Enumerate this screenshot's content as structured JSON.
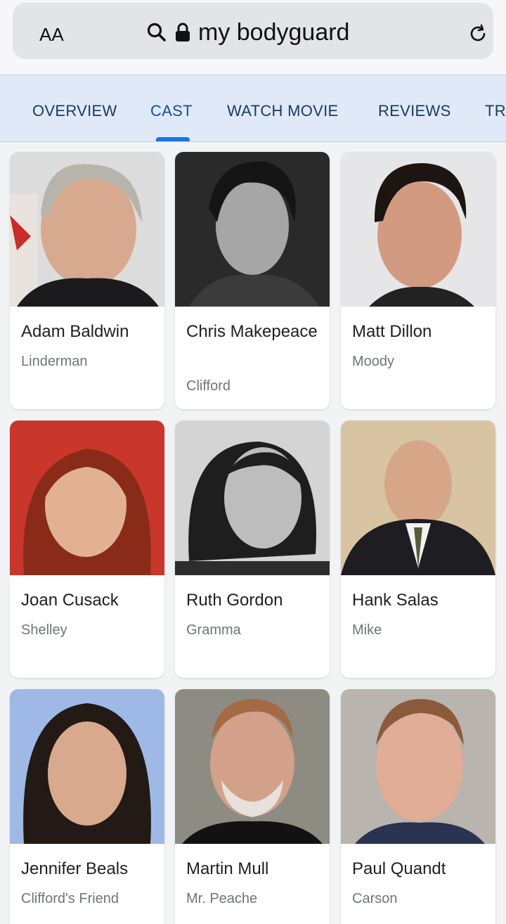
{
  "browser": {
    "aa_label": "AA",
    "url": "my bodyguard"
  },
  "tabs": [
    "OVERVIEW",
    "CAST",
    "WATCH MOVIE",
    "REVIEWS",
    "TR"
  ],
  "active_tab": "CAST",
  "cast": [
    {
      "name": "Adam Baldwin",
      "role": "Linderman"
    },
    {
      "name": "Chris Makepeace",
      "role": "Clifford"
    },
    {
      "name": "Matt Dillon",
      "role": "Moody"
    },
    {
      "name": "Joan Cusack",
      "role": "Shelley"
    },
    {
      "name": "Ruth Gordon",
      "role": "Gramma"
    },
    {
      "name": "Hank Salas",
      "role": "Mike"
    },
    {
      "name": "Jennifer Beals",
      "role": "Clifford's Friend"
    },
    {
      "name": "Martin Mull",
      "role": "Mr. Peache"
    },
    {
      "name": "Paul Quandt",
      "role": "Carson"
    }
  ]
}
